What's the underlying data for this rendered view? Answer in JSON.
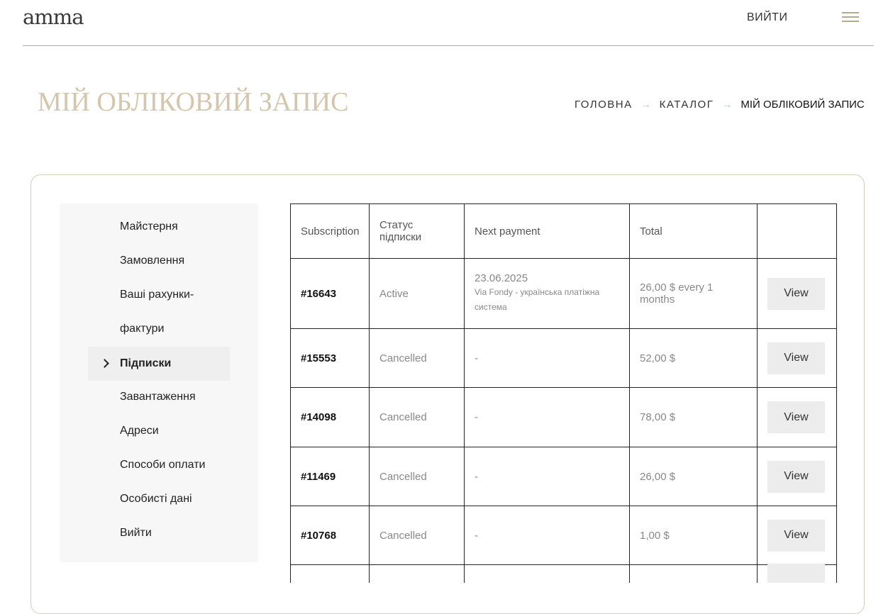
{
  "header": {
    "logo": "amma",
    "logout": "ВИЙТИ"
  },
  "page": {
    "title": "МІЙ ОБЛІКОВИЙ ЗАПИС"
  },
  "breadcrumb": {
    "items": [
      "ГОЛОВНА",
      "КАТАЛОГ",
      "МІЙ ОБЛІКОВИЙ ЗАПИС"
    ],
    "separator": "→"
  },
  "sidebar": {
    "items": [
      {
        "label": "Майстерня"
      },
      {
        "label": "Замовлення"
      },
      {
        "label": "Ваші рахунки-"
      },
      {
        "label": "фактури"
      },
      {
        "label": "Підписки",
        "active": true
      },
      {
        "label": "Завантаження"
      },
      {
        "label": "Адреси"
      },
      {
        "label": "Способи оплати"
      },
      {
        "label": "Особисті дані"
      },
      {
        "label": "Вийти"
      }
    ]
  },
  "table": {
    "headers": [
      "Subscription",
      "Статус підписки",
      "Next payment",
      "Total",
      ""
    ],
    "view_label": "View",
    "rows": [
      {
        "id": "#16643",
        "status": "Active",
        "next_payment": "23.06.2025",
        "payment_note": "Via Fondy - українська платіжна система",
        "total": "26,00 $ every 1 months"
      },
      {
        "id": "#15553",
        "status": "Cancelled",
        "next_payment": "-",
        "payment_note": "",
        "total": "52,00 $"
      },
      {
        "id": "#14098",
        "status": "Cancelled",
        "next_payment": "-",
        "payment_note": "",
        "total": "78,00 $"
      },
      {
        "id": "#11469",
        "status": "Cancelled",
        "next_payment": "-",
        "payment_note": "",
        "total": "26,00 $"
      },
      {
        "id": "#10768",
        "status": "Cancelled",
        "next_payment": "-",
        "payment_note": "",
        "total": "1,00 $"
      }
    ]
  }
}
